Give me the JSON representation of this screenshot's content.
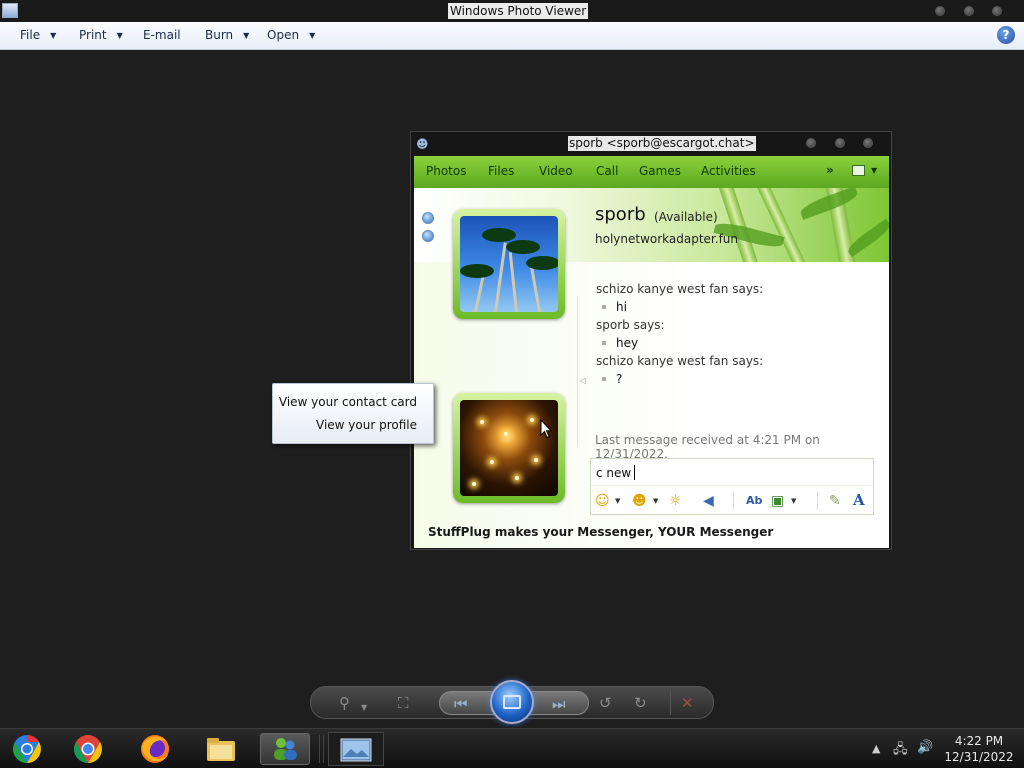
{
  "photo_viewer": {
    "title": "Windows Photo Viewer",
    "menu": {
      "file": "File",
      "print": "Print",
      "email": "E-mail",
      "burn": "Burn",
      "open": "Open"
    },
    "help_label": "?"
  },
  "messenger": {
    "title": "sporb <sporb@escargot.chat>",
    "toolbar": {
      "photos": "Photos",
      "files": "Files",
      "video": "Video",
      "call": "Call",
      "games": "Games",
      "activities": "Activities",
      "more": "»"
    },
    "contact": {
      "name": "sporb",
      "status": "(Available)",
      "personal_message": "holynetworkadapter.fun"
    },
    "conversation": [
      {
        "speaker": "schizo kanye west fan says:",
        "message": "hi"
      },
      {
        "speaker": "sporb says:",
        "message": "hey"
      },
      {
        "speaker": "schizo kanye west fan says:",
        "message": "?"
      }
    ],
    "last_message": "Last message received at 4:21 PM on 12/31/2022.",
    "input_value": "c new",
    "footer_ad": "StuffPlug makes your Messenger, YOUR Messenger"
  },
  "context_menu": {
    "items": [
      "View your contact card",
      "View your profile"
    ]
  },
  "taskbar": {
    "clock_time": "4:22 PM",
    "clock_date": "12/31/2022"
  },
  "icons": {
    "app": "photo-viewer-icon",
    "help": "help-icon",
    "emoticon": "emoticon-icon",
    "wink": "wink-icon",
    "nudge": "nudge-icon",
    "voice_clip": "voice-clip-icon",
    "font": "font-icon"
  }
}
